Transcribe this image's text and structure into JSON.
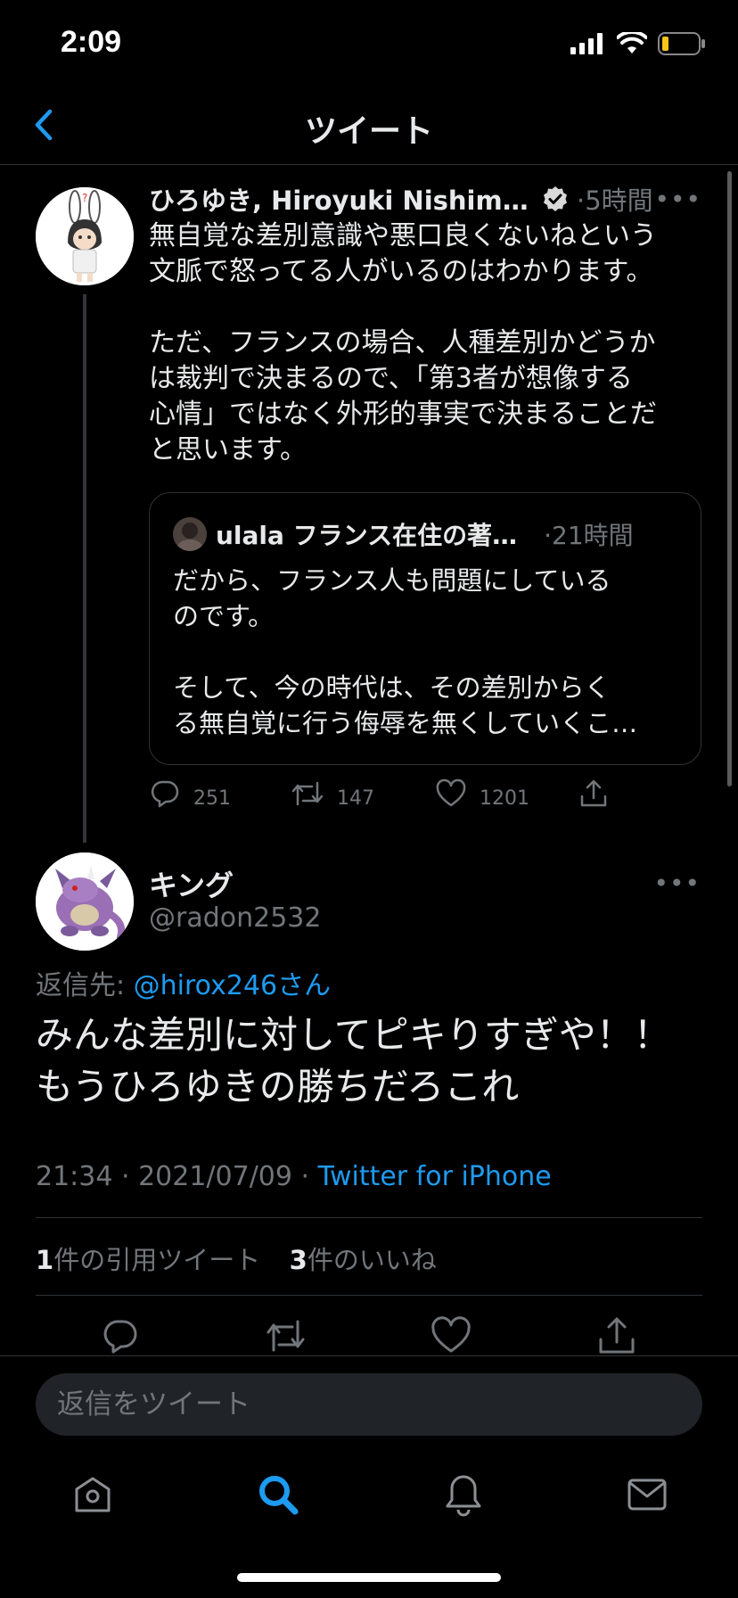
{
  "status_bar": {
    "time": "2:09"
  },
  "nav": {
    "title": "ツイート"
  },
  "parent_tweet": {
    "name": "ひろゆき, Hiroyuki Nishimu…",
    "time": "·5時間",
    "text": "無自覚な差別意識や悪口良くないねという\n文脈で怒ってる人がいるのはわかります。\n\nただ、フランスの場合、人種差別かどうか\nは裁判で決まるので、「第3者が想像する\n心情」ではなく外形的事実で決まることだ\nと思います。",
    "quote": {
      "name": "ulala フランス在住の著…",
      "time": "·21時間",
      "text": "だから、フランス人も問題にしている\nのです。\n\nそして、今の時代は、その差別からく\nる無自覚に行う侮辱を無くしていくこ…"
    },
    "replies": "251",
    "retweets": "147",
    "likes": "1201"
  },
  "main_tweet": {
    "name": "キング",
    "handle": "@radon2532",
    "reply_prefix": "返信先: ",
    "reply_mention": "@hirox246さん",
    "text": "みんな差別に対してピキりすぎや！！\nもうひろゆきの勝ちだろこれ",
    "timestamp": "21:34 · 2021/07/09 · ",
    "source": "Twitter for iPhone",
    "quote_count": "1",
    "quote_label": "件の引用ツイート",
    "like_count": "3",
    "like_label": "件のいいね"
  },
  "reply_bar": {
    "placeholder": "返信をツイート"
  },
  "tabs": [
    "home-icon",
    "search-icon",
    "bell-icon",
    "mail-icon"
  ],
  "colors": {
    "accent": "#1d9bf0",
    "background": "#000000",
    "muted": "#71767b",
    "text": "#e7e9ea"
  }
}
